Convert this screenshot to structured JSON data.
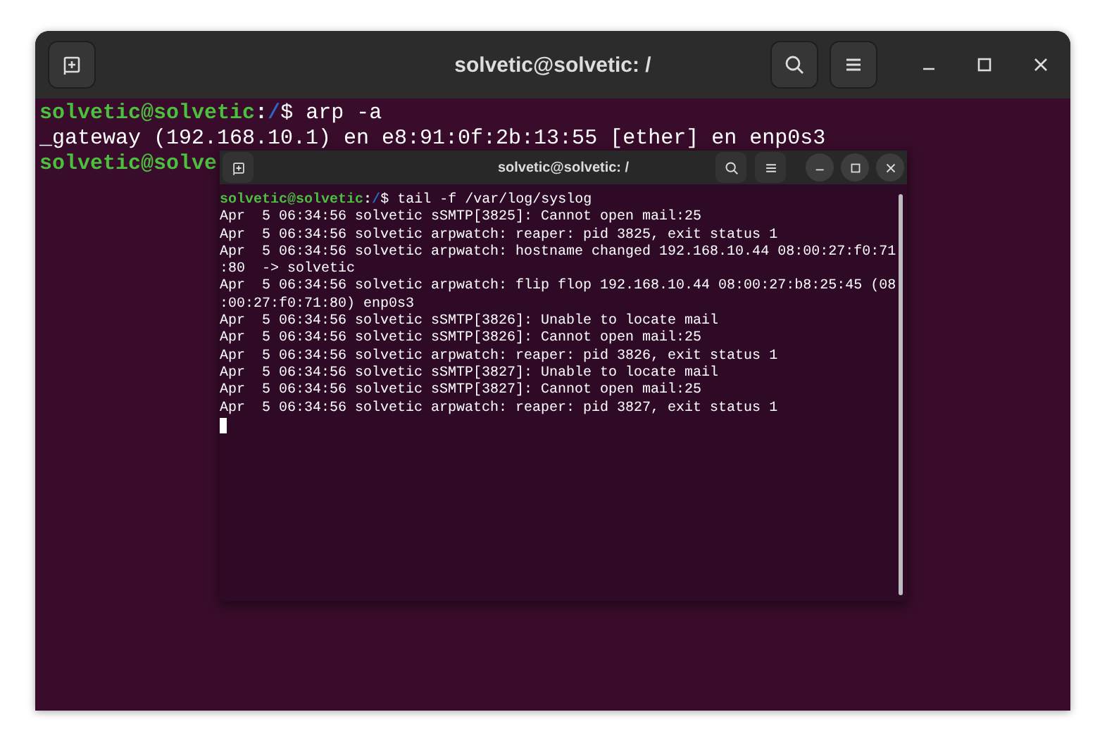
{
  "window": {
    "title": "solvetic@solvetic: /",
    "lines": [
      {
        "kind": "prompt",
        "user": "solvetic@solvetic",
        "sep": ":",
        "path": "/",
        "command": "$ arp -a"
      },
      {
        "kind": "output",
        "text": "_gateway (192.168.10.1) en e8:91:0f:2b:13:55 [ether] en enp0s3"
      },
      {
        "kind": "prompt",
        "user": "solvetic@solve"
      }
    ]
  },
  "inner_window": {
    "title": "solvetic@solvetic: /",
    "lines": [
      {
        "kind": "prompt",
        "user": "solvetic@solvetic",
        "sep": ":",
        "path": "/",
        "command": "$ tail -f /var/log/syslog"
      },
      {
        "kind": "output",
        "text": "Apr  5 06:34:56 solvetic sSMTP[3825]: Cannot open mail:25"
      },
      {
        "kind": "output",
        "text": "Apr  5 06:34:56 solvetic arpwatch: reaper: pid 3825, exit status 1"
      },
      {
        "kind": "output",
        "text": "Apr  5 06:34:56 solvetic arpwatch: hostname changed 192.168.10.44 08:00:27:f0:71"
      },
      {
        "kind": "output",
        "text": ":80  -> solvetic"
      },
      {
        "kind": "output",
        "text": "Apr  5 06:34:56 solvetic arpwatch: flip flop 192.168.10.44 08:00:27:b8:25:45 (08"
      },
      {
        "kind": "output",
        "text": ":00:27:f0:71:80) enp0s3"
      },
      {
        "kind": "output",
        "text": "Apr  5 06:34:56 solvetic sSMTP[3826]: Unable to locate mail"
      },
      {
        "kind": "output",
        "text": "Apr  5 06:34:56 solvetic sSMTP[3826]: Cannot open mail:25"
      },
      {
        "kind": "output",
        "text": "Apr  5 06:34:56 solvetic arpwatch: reaper: pid 3826, exit status 1"
      },
      {
        "kind": "output",
        "text": "Apr  5 06:34:56 solvetic sSMTP[3827]: Unable to locate mail"
      },
      {
        "kind": "output",
        "text": "Apr  5 06:34:56 solvetic sSMTP[3827]: Cannot open mail:25"
      },
      {
        "kind": "output",
        "text": "Apr  5 06:34:56 solvetic arpwatch: reaper: pid 3827, exit status 1"
      },
      {
        "kind": "cursor"
      }
    ]
  }
}
